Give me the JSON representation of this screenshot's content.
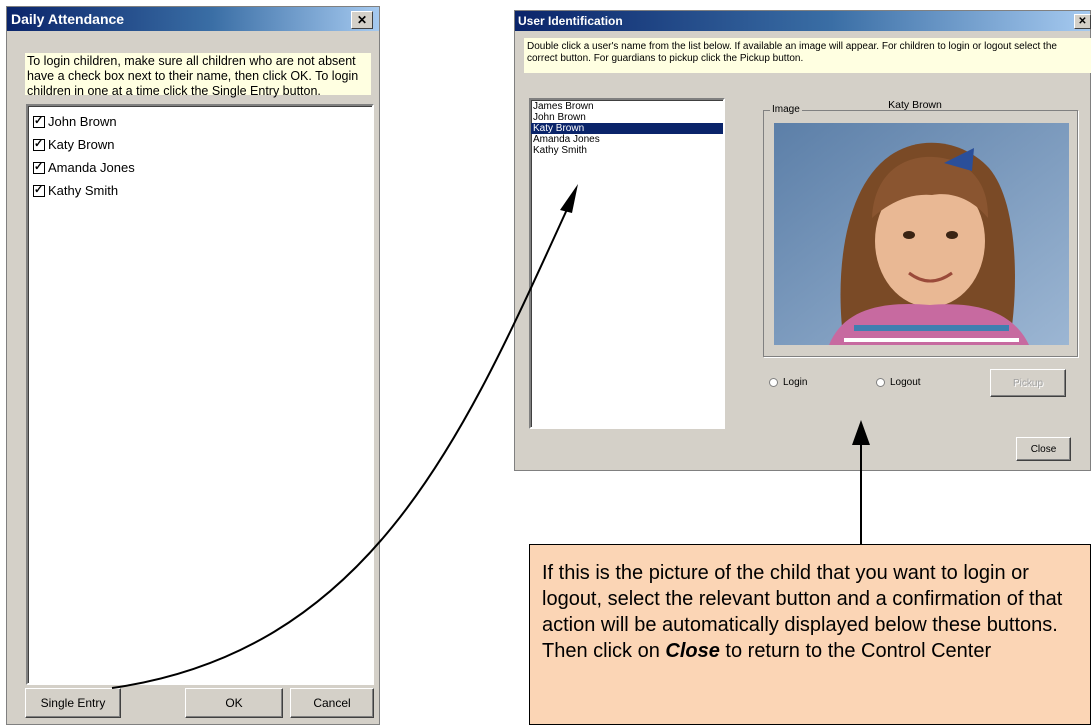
{
  "daily_attendance": {
    "title": "Daily Attendance",
    "close_glyph": "✕",
    "instructions": "To login children, make sure all children who are not absent have a check box next to their name, then click OK. To login children in one at a time click the Single Entry button.",
    "children": [
      {
        "name": "John Brown",
        "checked": true
      },
      {
        "name": "Katy Brown",
        "checked": true
      },
      {
        "name": "Amanda Jones",
        "checked": true
      },
      {
        "name": "Kathy Smith",
        "checked": true
      }
    ],
    "single_entry_label": "Single Entry",
    "ok_label": "OK",
    "cancel_label": "Cancel"
  },
  "user_identification": {
    "title": "User Identification",
    "close_glyph": "✕",
    "instructions": "Double click a user's name from the list below. If available an image will appear. For children to login or logout select the correct button. For guardians to pickup click the Pickup button.",
    "users": [
      "James Brown",
      "John Brown",
      "Katy Brown",
      "Amanda Jones",
      "Kathy Smith"
    ],
    "selected_user": "Katy Brown",
    "image_group_label": "Image",
    "login_label": "Login",
    "logout_label": "Logout",
    "pickup_label": "Pickup",
    "close_label": "Close"
  },
  "note": {
    "text_before": "If this is the picture of the child that you want to login or logout, select the relevant button and a confirmation of that action will be automatically displayed below these buttons. Then click on ",
    "emphasis": "Close",
    "text_after": " to return to the Control Center"
  },
  "colors": {
    "title_bar": "#0a246a",
    "selection": "#0a246a",
    "instruction_bg": "#ffffe1",
    "note_bg": "#fbd5b5"
  }
}
